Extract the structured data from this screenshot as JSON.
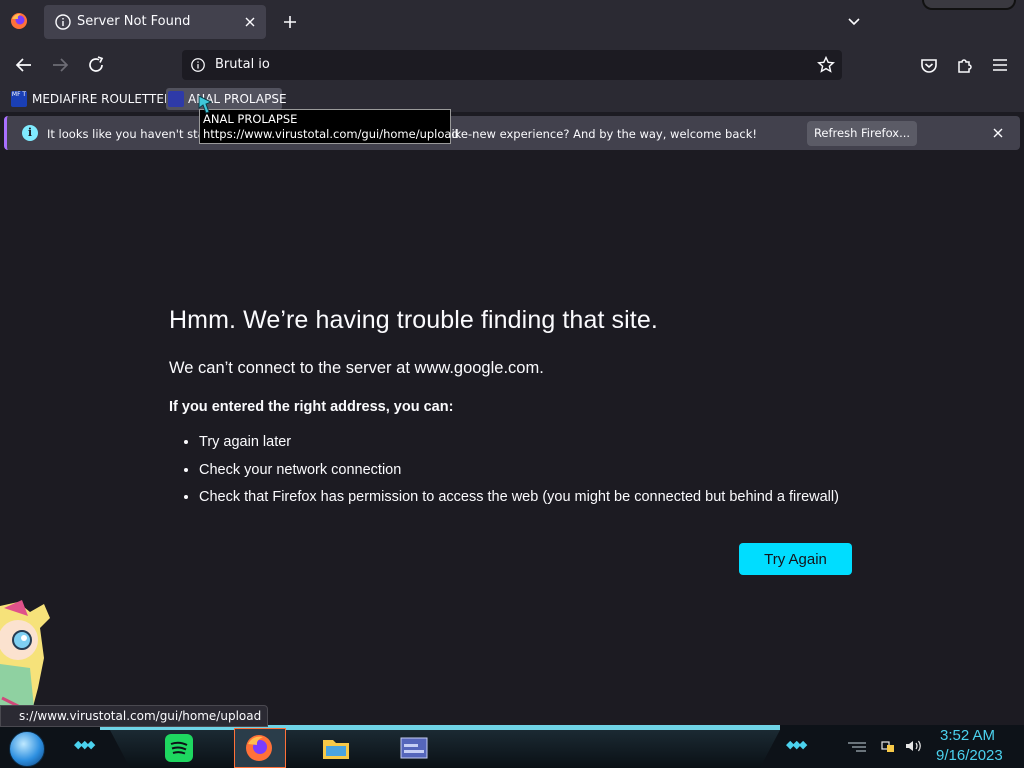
{
  "tab": {
    "title": "Server Not Found"
  },
  "urlbar": {
    "text": "Brutal io"
  },
  "bookmarks": [
    {
      "label": "MEDIAFIRE ROULETTER",
      "favicon_text": "MF T"
    },
    {
      "label": "ANAL PROLAPSE"
    }
  ],
  "tooltip": {
    "title": "ANAL PROLAPSE",
    "url": "https://www.virustotal.com/gui/home/upload"
  },
  "notification": {
    "message": "It looks like you haven't starte",
    "message_tail": "or a fresh, like-new experience? And by the way, welcome back!",
    "button": "Refresh Firefox..."
  },
  "error": {
    "title": "Hmm. We’re having trouble finding that site.",
    "short": "We can’t connect to the server at www.google.com.",
    "hint": "If you entered the right address, you can:",
    "items": [
      "Try again later",
      "Check your network connection",
      "Check that Firefox has permission to access the web (you might be connected but behind a firewall)"
    ],
    "button": "Try Again"
  },
  "status_link": "s://www.virustotal.com/gui/home/upload",
  "taskbar": {
    "icons": [
      "spotify-icon",
      "firefox-icon",
      "file-explorer-icon",
      "app-window-icon"
    ],
    "clock_time": "3:52 AM",
    "clock_date": "9/16/2023"
  },
  "colors": {
    "accent": "#00ddff",
    "page_bg": "#1c1b22",
    "toolbar_bg": "#2b2a33",
    "notification_bg": "#42414d",
    "taskbar_accent": "#4bd2ee"
  }
}
